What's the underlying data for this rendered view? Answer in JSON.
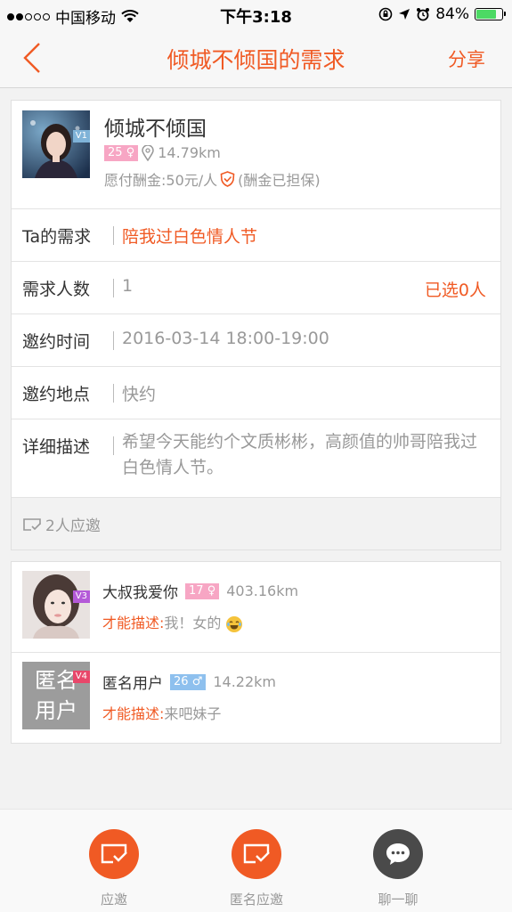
{
  "status_bar": {
    "carrier": "中国移动",
    "time": "下午3:18",
    "battery": "84%",
    "battery_level": 0.84
  },
  "nav": {
    "title": "倾城不倾国的需求",
    "share_label": "分享"
  },
  "requester": {
    "name": "倾城不倾国",
    "vip": "V1",
    "age": "25",
    "gender_symbol": "♀",
    "distance": "14.79km",
    "fee": "愿付酬金:50元/人",
    "fee_note": "(酬金已担保)"
  },
  "details": [
    {
      "label": "Ta的需求",
      "value": "陪我过白色情人节",
      "highlight": true,
      "extra": ""
    },
    {
      "label": "需求人数",
      "value": "1",
      "highlight": false,
      "extra": "已选0人"
    },
    {
      "label": "邀约时间",
      "value": "2016-03-14 18:00-19:00",
      "highlight": false,
      "extra": ""
    },
    {
      "label": "邀约地点",
      "value": "快约",
      "highlight": false,
      "extra": ""
    },
    {
      "label": "详细描述",
      "value": "希望今天能约个文质彬彬，高颜值的帅哥陪我过白色情人节。",
      "highlight": false,
      "extra": ""
    }
  ],
  "respond_count": "2人应邀",
  "responses": [
    {
      "name": "大叔我爱你",
      "vip": "V3",
      "age": "17",
      "gender_symbol": "♀",
      "distance": "403.16km",
      "desc_key": "才能描述:",
      "desc": "我！女的"
    },
    {
      "name": "匿名用户",
      "vip": "V4",
      "age": "26",
      "gender_symbol": "♂",
      "distance": "14.22km",
      "desc_key": "才能描述:",
      "desc": "来吧妹子",
      "avatar_text_1": "匿名",
      "avatar_text_2": "用户"
    }
  ],
  "tabs": [
    {
      "label": "应邀"
    },
    {
      "label": "匿名应邀"
    },
    {
      "label": "聊一聊"
    }
  ],
  "colors": {
    "accent": "#f05a24",
    "female": "#f7a6c4",
    "male": "#8ec0ee",
    "chat": "#4a4a4a"
  }
}
